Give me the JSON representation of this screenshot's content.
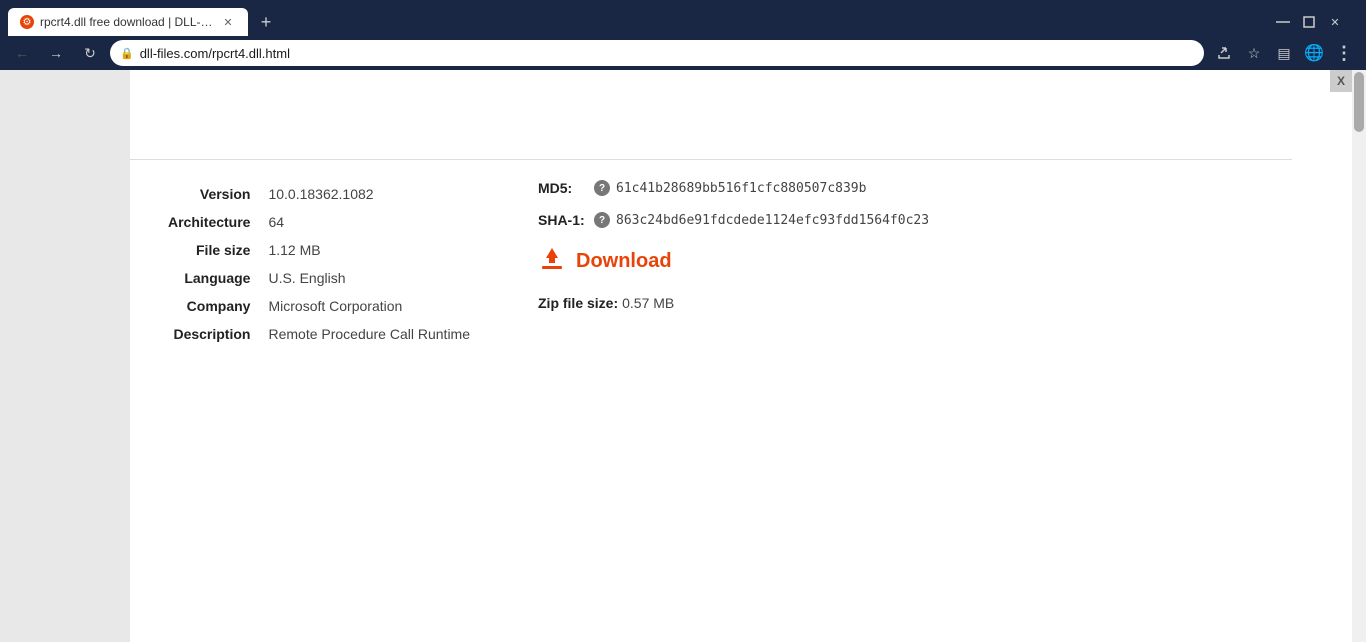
{
  "browser": {
    "tab_title": "rpcrt4.dll free download | DLL-fi...",
    "favicon_text": "●",
    "url": "dll-files.com/rpcrt4.dll.html",
    "new_tab_icon": "+",
    "nav": {
      "back": "←",
      "forward": "→",
      "refresh": "↻"
    },
    "window_controls": {
      "minimize": "─",
      "maximize": "□",
      "close": "✕"
    },
    "tab_close": "✕"
  },
  "toolbar": {
    "share_icon": "⎙",
    "bookmark_icon": "☆",
    "sidebar_icon": "▤",
    "globe_icon": "🌐",
    "menu_icon": "⋮"
  },
  "file_info": {
    "version_label": "Version",
    "version_value": "10.0.18362.1082",
    "architecture_label": "Architecture",
    "architecture_value": "64",
    "file_size_label": "File size",
    "file_size_value": "1.12 MB",
    "language_label": "Language",
    "language_value": "U.S. English",
    "company_label": "Company",
    "company_value": "Microsoft Corporation",
    "description_label": "Description",
    "description_value": "Remote Procedure Call Runtime"
  },
  "hash_info": {
    "md5_label": "MD5:",
    "md5_value": "61c41b28689bb516f1cfc880507c839b",
    "sha1_label": "SHA-1:",
    "sha1_value": "863c24bd6e91fdcdede1124efc93fdd1564f0c23",
    "info_icon": "?"
  },
  "download": {
    "label": "Download",
    "zip_size_label": "Zip file size:",
    "zip_size_value": "0.57 MB",
    "download_icon": "⬇"
  },
  "close_button": "X"
}
